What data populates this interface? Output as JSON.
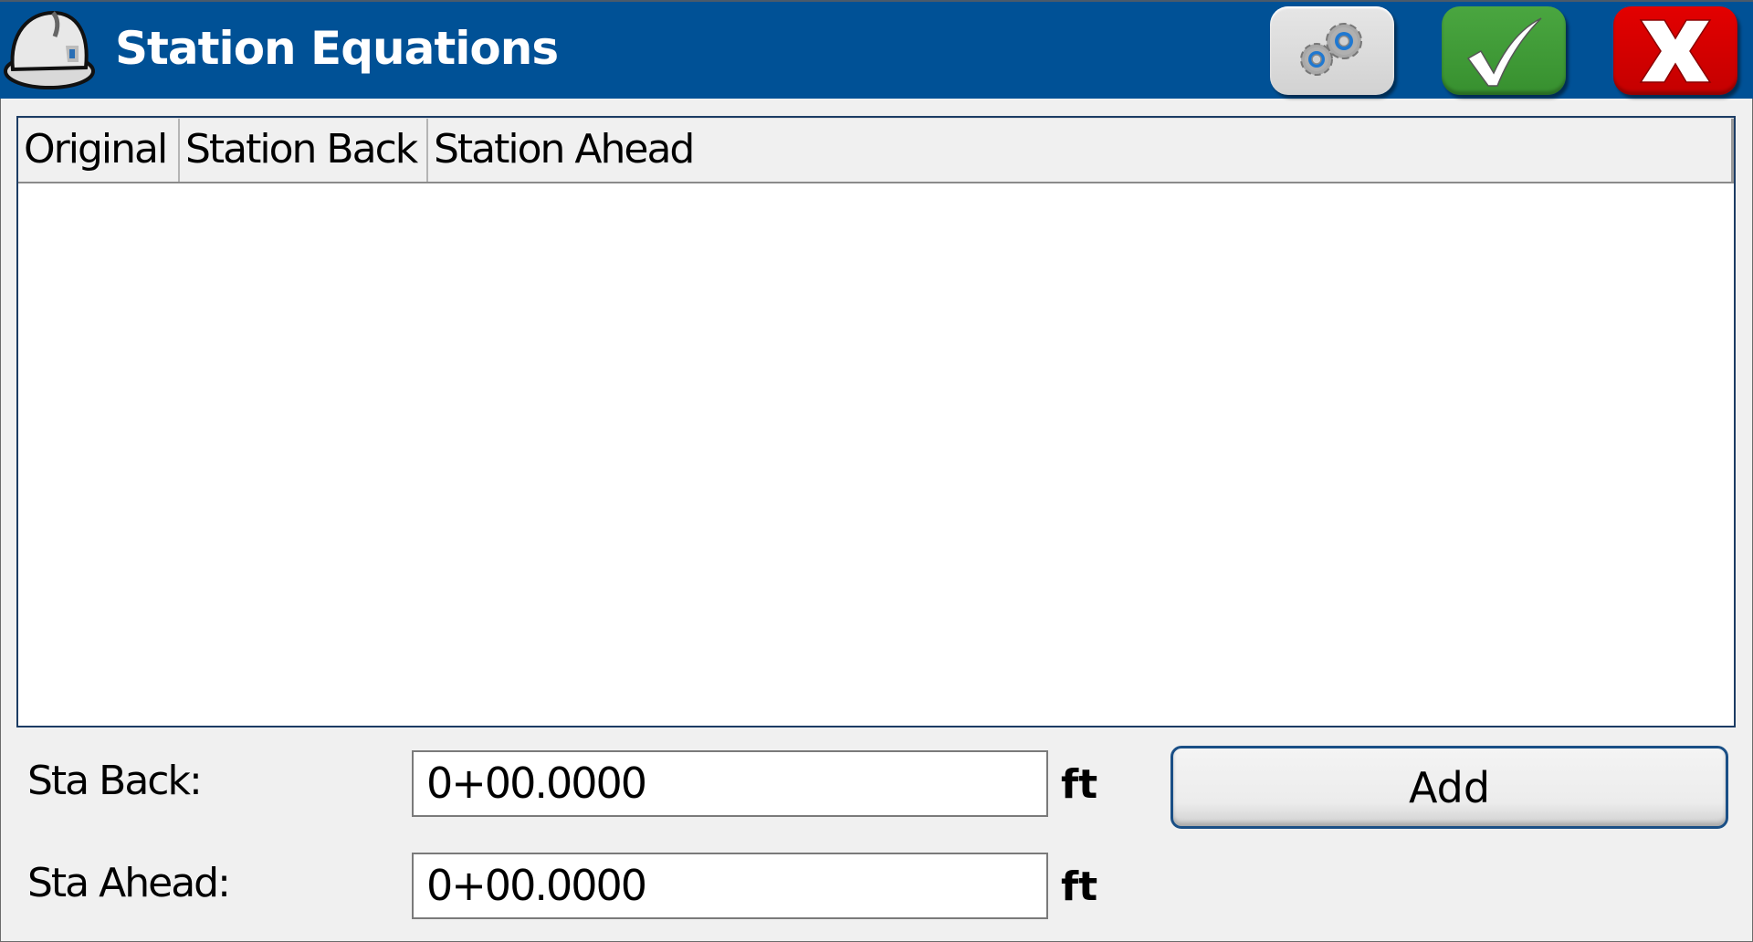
{
  "window": {
    "title": "Station Equations",
    "app_icon": "hard-hat-icon"
  },
  "toolbar": {
    "settings_icon": "gears-icon",
    "ok_icon": "checkmark-icon",
    "cancel_icon": "close-x-icon"
  },
  "colors": {
    "titlebar": "#005196",
    "ok_button": "#3f9c36",
    "cancel_button": "#d80000",
    "table_border": "#1c3c64"
  },
  "table": {
    "columns": [
      "Original",
      "Station Back",
      "Station Ahead"
    ],
    "rows": []
  },
  "form": {
    "sta_back": {
      "label": "Sta Back:",
      "value": "0+00.0000",
      "unit": "ft"
    },
    "sta_ahead": {
      "label": "Sta Ahead:",
      "value": "0+00.0000",
      "unit": "ft"
    },
    "add_label": "Add"
  }
}
